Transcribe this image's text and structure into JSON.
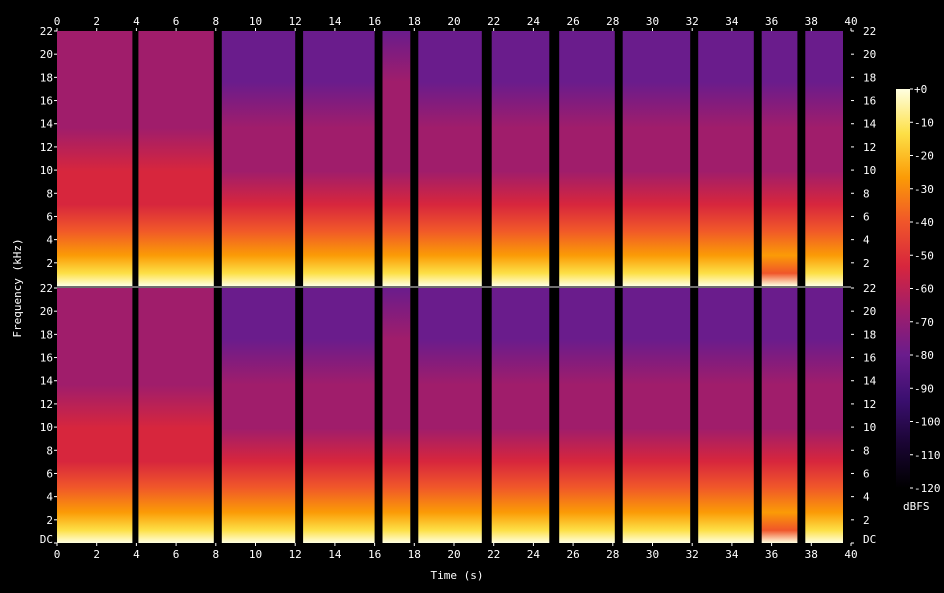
{
  "chart_data": {
    "type": "heatmap",
    "title": "",
    "xlabel": "Time (s)",
    "ylabel": "Frequency (kHz)",
    "xlim": [
      0,
      40
    ],
    "ylim": [
      0,
      22
    ],
    "x_ticks": [
      "0",
      "2",
      "4",
      "6",
      "8",
      "10",
      "12",
      "14",
      "16",
      "18",
      "20",
      "22",
      "24",
      "26",
      "28",
      "30",
      "32",
      "34",
      "36",
      "38",
      "40"
    ],
    "y_ticks_top": [
      "22",
      "20",
      "18",
      "16",
      "14",
      "12",
      "10",
      "8",
      "6",
      "4",
      "2"
    ],
    "y_ticks_bottom": [
      "22",
      "20",
      "18",
      "16",
      "14",
      "12",
      "10",
      "8",
      "6",
      "4",
      "2",
      "DC"
    ],
    "channels": 2,
    "colorbar": {
      "label": "dBFS",
      "ticks": [
        "+0",
        "-10",
        "-20",
        "-30",
        "-40",
        "-50",
        "-60",
        "-70",
        "-80",
        "-90",
        "-100",
        "-110",
        "-120"
      ],
      "range": [
        -120,
        0
      ],
      "colormap": [
        "#000000",
        "#1a0533",
        "#3b0f70",
        "#6a1c8c",
        "#a01d6b",
        "#d7263d",
        "#f0562a",
        "#fb9b06",
        "#fde047",
        "#ffffe0"
      ]
    },
    "segments": [
      {
        "start": 0.0,
        "end": 3.8,
        "intensity": 0.95
      },
      {
        "start": 4.1,
        "end": 7.9,
        "intensity": 0.88
      },
      {
        "start": 8.3,
        "end": 12.0,
        "intensity": 0.78
      },
      {
        "start": 12.4,
        "end": 16.0,
        "intensity": 0.72
      },
      {
        "start": 16.4,
        "end": 17.8,
        "intensity": 0.82
      },
      {
        "start": 18.2,
        "end": 21.4,
        "intensity": 0.8
      },
      {
        "start": 21.9,
        "end": 24.8,
        "intensity": 0.72
      },
      {
        "start": 25.3,
        "end": 28.1,
        "intensity": 0.72
      },
      {
        "start": 28.5,
        "end": 31.9,
        "intensity": 0.8
      },
      {
        "start": 32.3,
        "end": 35.1,
        "intensity": 0.74
      },
      {
        "start": 35.5,
        "end": 37.3,
        "intensity": 0.55
      },
      {
        "start": 37.7,
        "end": 39.6,
        "intensity": 0.8
      }
    ]
  }
}
